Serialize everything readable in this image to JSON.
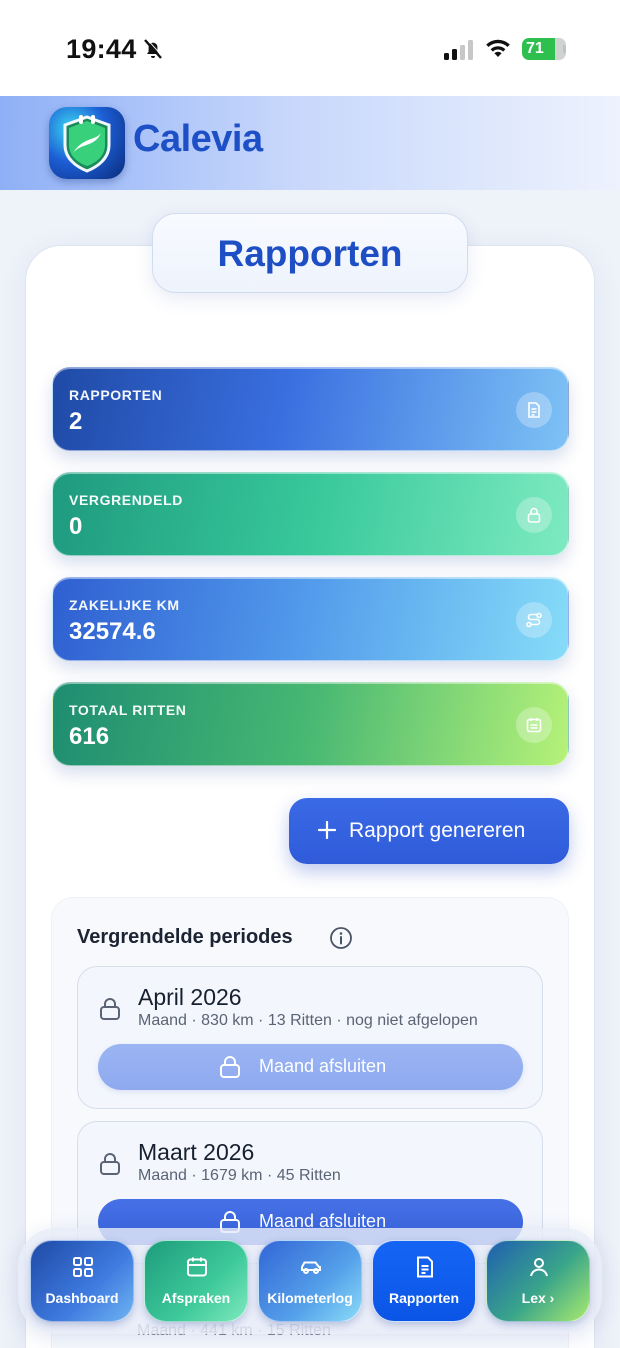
{
  "status_bar": {
    "time": "19:44",
    "battery": "71",
    "icons": [
      "bell-slash-icon",
      "cellular-signal-icon",
      "wifi-icon",
      "battery-charging-icon"
    ]
  },
  "brand": {
    "name": "Calevia",
    "logo_icon": "calevia-logo-icon"
  },
  "page": {
    "title": "Rapporten"
  },
  "stats": [
    {
      "label": "RAPPORTEN",
      "value": "2",
      "icon": "document-icon"
    },
    {
      "label": "VERGRENDELD",
      "value": "0",
      "icon": "lock-icon"
    },
    {
      "label": "ZAKELIJKE KM",
      "value": "32574.6",
      "icon": "route-icon"
    },
    {
      "label": "TOTAAL RITTEN",
      "value": "616",
      "icon": "calendar-icon"
    }
  ],
  "actions": {
    "generate_label": "Rapport genereren"
  },
  "locked_periods": {
    "title": "Vergrendelde periodes",
    "items": [
      {
        "name": "April 2026",
        "meta": "Maand · 830 km · 13 Ritten · nog niet afgelopen",
        "button": "Maand afsluiten",
        "enabled": false
      },
      {
        "name": "Maart 2026",
        "meta": "Maand · 1679 km · 45 Ritten",
        "button": "Maand afsluiten",
        "enabled": true
      }
    ],
    "peek_text": "Maand · 441 km · 15 Ritten"
  },
  "nav": {
    "items": [
      {
        "label": "Dashboard",
        "icon": "grid-icon"
      },
      {
        "label": "Afspraken",
        "icon": "calendar-icon"
      },
      {
        "label": "Kilometerlog",
        "icon": "car-icon"
      },
      {
        "label": "Rapporten",
        "icon": "document-icon",
        "active": true
      },
      {
        "label": "Lex ›",
        "icon": "user-icon"
      }
    ]
  },
  "colors": {
    "brand_blue": "#1d4fc7",
    "active_nav": "#0b55e6",
    "primary_button": "#2f5bd9"
  }
}
